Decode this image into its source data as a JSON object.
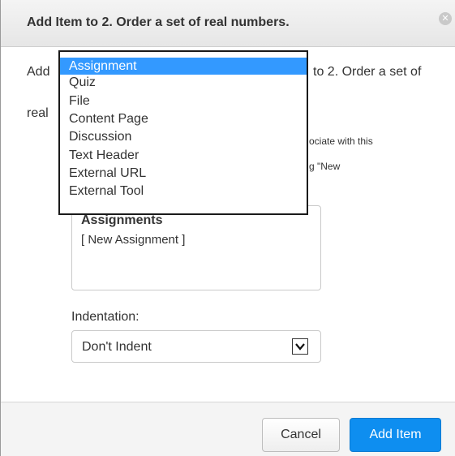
{
  "dialog": {
    "title": "Add Item to 2. Order a set of real numbers.",
    "close_glyph": "✕"
  },
  "intro": {
    "prefix": "Add",
    "suffix": "to 2. Order a set of",
    "line2": "real"
  },
  "hints": {
    "line1": "ociate with this",
    "line2": "g \"New"
  },
  "type_dropdown": {
    "options": [
      "Assignment",
      "Quiz",
      "File",
      "Content Page",
      "Discussion",
      "Text Header",
      "External URL",
      "External Tool"
    ],
    "selected": "Assignment"
  },
  "item_list": {
    "group_label": "Assignments",
    "items": [
      "[ New Assignment ]"
    ]
  },
  "indentation": {
    "label": "Indentation:",
    "value": "Don't Indent"
  },
  "buttons": {
    "cancel": "Cancel",
    "add_item": "Add Item"
  },
  "colors": {
    "primary": "#0e8ef0",
    "selection": "#3399ff"
  },
  "icons": {
    "close": "close-icon",
    "dropdown_arrow": "chevron-down-icon"
  }
}
